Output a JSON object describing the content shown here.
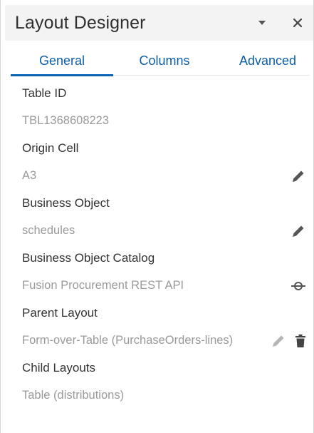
{
  "panel": {
    "title": "Layout Designer"
  },
  "tabs": [
    {
      "label": "General",
      "active": true
    },
    {
      "label": "Columns",
      "active": false
    },
    {
      "label": "Advanced",
      "active": false
    }
  ],
  "properties": [
    {
      "label": "Table ID",
      "value": "TBL1368608223",
      "actions": []
    },
    {
      "label": "Origin Cell",
      "value": "A3",
      "actions": [
        "edit-icon"
      ]
    },
    {
      "label": "Business Object",
      "value": "schedules",
      "actions": [
        "edit-icon"
      ]
    },
    {
      "label": "Business Object Catalog",
      "value": "Fusion Procurement REST API",
      "actions": [
        "connection-icon"
      ]
    },
    {
      "label": "Parent Layout",
      "value": "Form-over-Table (PurchaseOrders-lines)",
      "actions": [
        "edit-icon",
        "delete-icon"
      ]
    },
    {
      "label": "Child Layouts",
      "value": "Table (distributions)",
      "actions": []
    }
  ],
  "colors": {
    "accent": "#0a64b4",
    "tab_text": "#0b5ea8",
    "title_bar": "#f3f3f3",
    "value_text": "#9a9a9a"
  }
}
